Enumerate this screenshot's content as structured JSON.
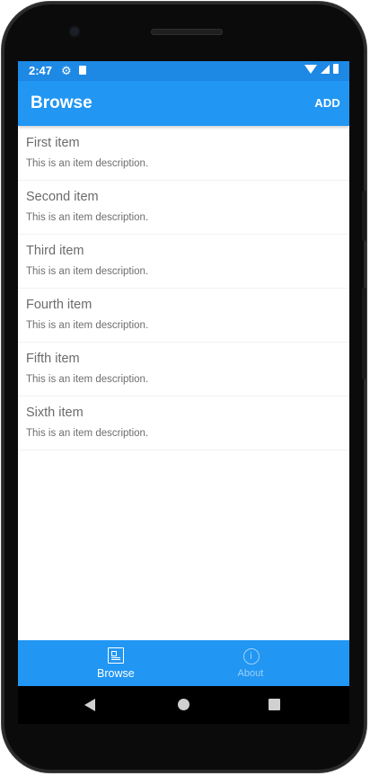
{
  "status_bar": {
    "time": "2:47"
  },
  "toolbar": {
    "title": "Browse",
    "add_label": "ADD"
  },
  "items": [
    {
      "title": "First item",
      "description": "This is an item description."
    },
    {
      "title": "Second item",
      "description": "This is an item description."
    },
    {
      "title": "Third item",
      "description": "This is an item description."
    },
    {
      "title": "Fourth item",
      "description": "This is an item description."
    },
    {
      "title": "Fifth item",
      "description": "This is an item description."
    },
    {
      "title": "Sixth item",
      "description": "This is an item description."
    }
  ],
  "tabs": {
    "browse": {
      "label": "Browse",
      "icon": "browse-icon",
      "selected": true
    },
    "about": {
      "label": "About",
      "icon": "info-icon",
      "selected": false
    }
  },
  "colors": {
    "primary": "#2196f3",
    "status_bar": "#1e88e5",
    "tab_inactive": "#9fd0f6"
  }
}
